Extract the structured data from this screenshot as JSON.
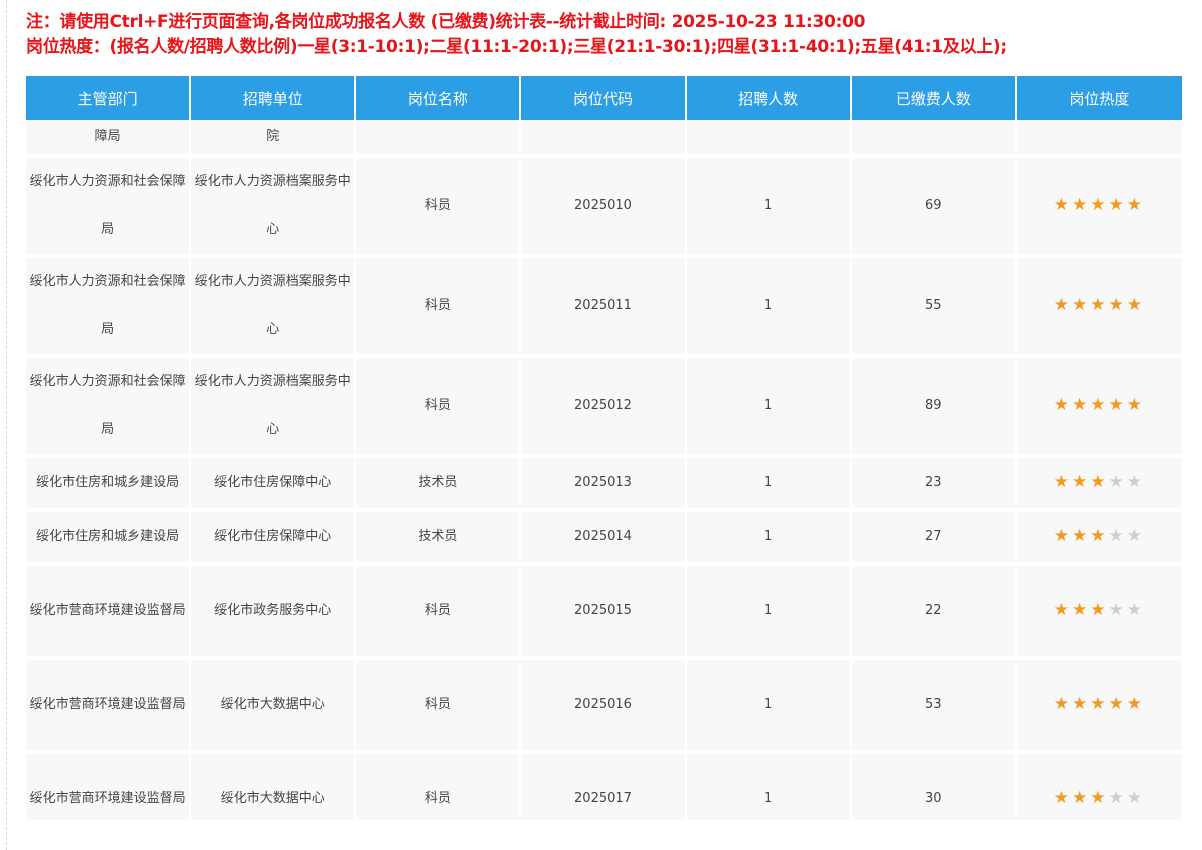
{
  "notes": {
    "line1": "注：请使用Ctrl+F进行页面查询,各岗位成功报名人数 (已缴费)统计表--统计截止时间: 2025-10-23 11:30:00",
    "line2": "岗位热度：(报名人数/招聘人数比例)一星(3:1-10:1);二星(11:1-20:1);三星(21:1-30:1);四星(31:1-40:1);五星(41:1及以上);"
  },
  "columns": [
    "主管部门",
    "招聘单位",
    "岗位名称",
    "岗位代码",
    "招聘人数",
    "已缴费人数",
    "岗位热度"
  ],
  "colors": {
    "header": "#2b9ee6",
    "star_on": "#f39a1e",
    "star_off": "#cfcfcf",
    "notes": "#e8141a"
  },
  "rows": [
    {
      "dept": "障局",
      "unit": "院",
      "position": "",
      "code": "",
      "hires": "",
      "paid": "",
      "stars": 0
    },
    {
      "dept": "绥化市人力资源和社会保障局",
      "unit": "绥化市人力资源档案服务中心",
      "position": "科员",
      "code": "2025010",
      "hires": "1",
      "paid": "69",
      "stars": 5
    },
    {
      "dept": "绥化市人力资源和社会保障局",
      "unit": "绥化市人力资源档案服务中心",
      "position": "科员",
      "code": "2025011",
      "hires": "1",
      "paid": "55",
      "stars": 5
    },
    {
      "dept": "绥化市人力资源和社会保障局",
      "unit": "绥化市人力资源档案服务中心",
      "position": "科员",
      "code": "2025012",
      "hires": "1",
      "paid": "89",
      "stars": 5
    },
    {
      "dept": "绥化市住房和城乡建设局",
      "unit": "绥化市住房保障中心",
      "position": "技术员",
      "code": "2025013",
      "hires": "1",
      "paid": "23",
      "stars": 3
    },
    {
      "dept": "绥化市住房和城乡建设局",
      "unit": "绥化市住房保障中心",
      "position": "技术员",
      "code": "2025014",
      "hires": "1",
      "paid": "27",
      "stars": 3
    },
    {
      "dept": "绥化市营商环境建设监督局",
      "unit": "绥化市政务服务中心",
      "position": "科员",
      "code": "2025015",
      "hires": "1",
      "paid": "22",
      "stars": 3
    },
    {
      "dept": "绥化市营商环境建设监督局",
      "unit": "绥化市大数据中心",
      "position": "科员",
      "code": "2025016",
      "hires": "1",
      "paid": "53",
      "stars": 5
    },
    {
      "dept": "绥化市营商环境建设监督局",
      "unit": "绥化市大数据中心",
      "position": "科员",
      "code": "2025017",
      "hires": "1",
      "paid": "30",
      "stars": 3
    }
  ]
}
